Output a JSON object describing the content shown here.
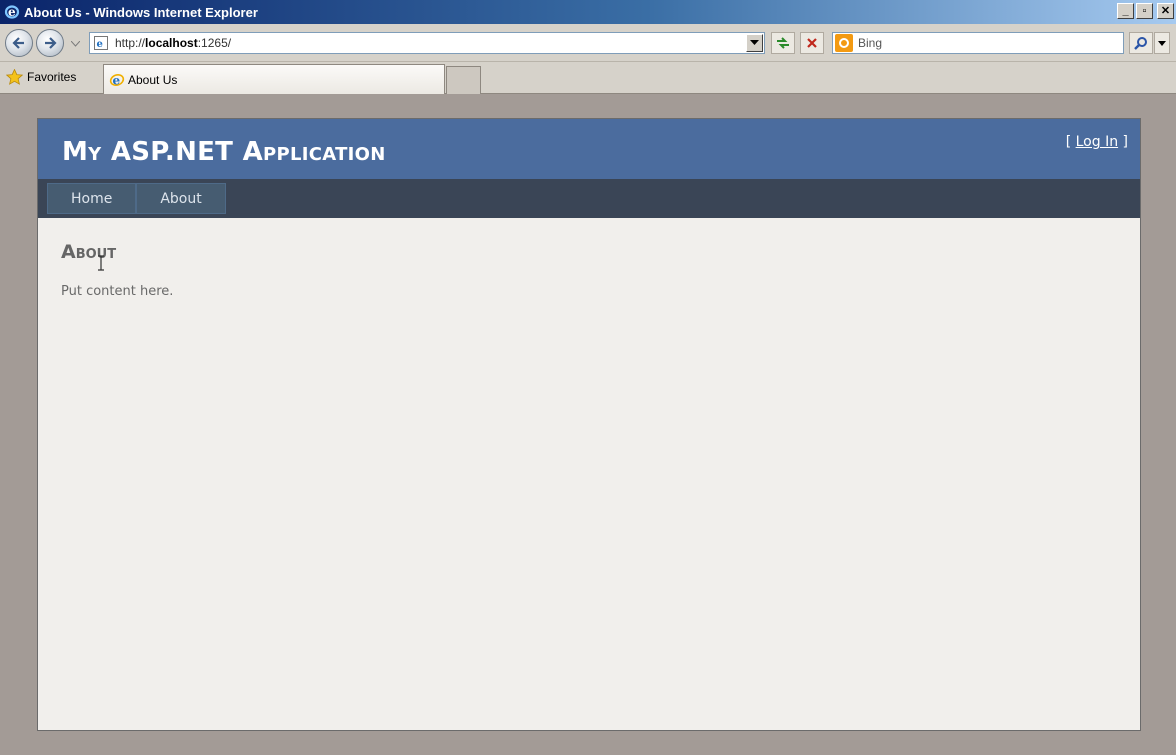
{
  "window": {
    "title": "About Us - Windows Internet Explorer",
    "controls": {
      "minimize": "_",
      "maximize": "▫",
      "close": "✕"
    }
  },
  "toolbar": {
    "url_prefix": "http://",
    "url_host": "localhost",
    "url_suffix": ":1265/",
    "search_placeholder": "Bing"
  },
  "favorites_bar": {
    "favorites_label": "Favorites",
    "tabs": [
      {
        "label": "About Us",
        "active": true
      }
    ]
  },
  "site": {
    "title": "My ASP.NET Application",
    "login": {
      "open": "[ ",
      "link": "Log In",
      "close": " ]"
    },
    "menu": [
      {
        "label": "Home"
      },
      {
        "label": "About"
      }
    ],
    "heading": "About",
    "body": "Put content here."
  },
  "colors": {
    "header": "#4b6c9e",
    "menubar": "#3a4556",
    "menu_item": "#465c71",
    "page_bg": "#f1efec"
  }
}
